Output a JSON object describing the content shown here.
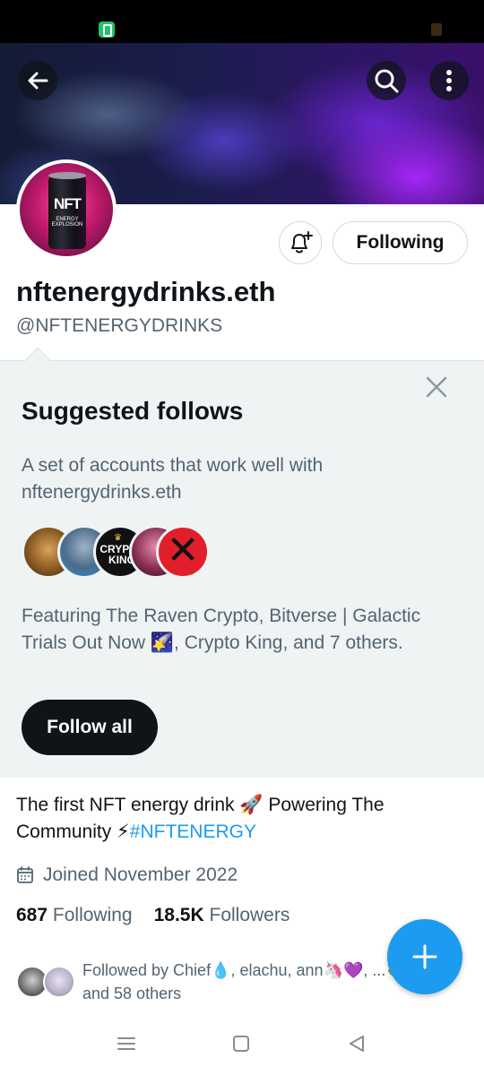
{
  "profile": {
    "display_name": "nftenergydrinks.eth",
    "handle": "@NFTENERGYDRINKS",
    "following_button": "Following",
    "avatar_text": "NFT",
    "avatar_subtext": "ENERGY EXPLOSION",
    "bio_text": "The first NFT energy drink 🚀 Powering The Community ⚡",
    "bio_hashtag": "#NFTENERGY",
    "joined": "Joined November 2022",
    "following_count": "687",
    "following_label": "Following",
    "followers_count": "18.5K",
    "followers_label": "Followers"
  },
  "suggested": {
    "title": "Suggested follows",
    "description": "A set of accounts that work well with nftenergydrinks.eth",
    "featuring": "Featuring The Raven Crypto, Bitverse | Galactic Trials Out Now 🌠, Crypto King, and 7 others.",
    "follow_all": "Follow all",
    "crypto_king_avatar_text": "CRYPTO KING"
  },
  "followed_by": {
    "text": "Followed by Chief💧, elachu, ann🦄💜, ...🍀🍀🍀, and 58 others"
  },
  "icons": {
    "back": "arrow-left-icon",
    "search": "search-icon",
    "more": "more-vertical-icon",
    "bell": "bell-plus-icon",
    "close": "close-icon",
    "calendar": "calendar-icon",
    "compose": "plus-icon"
  },
  "colors": {
    "accent": "#1d9bf0",
    "text": "#0f1419",
    "secondary_text": "#536471",
    "card_bg": "#eff3f4"
  }
}
